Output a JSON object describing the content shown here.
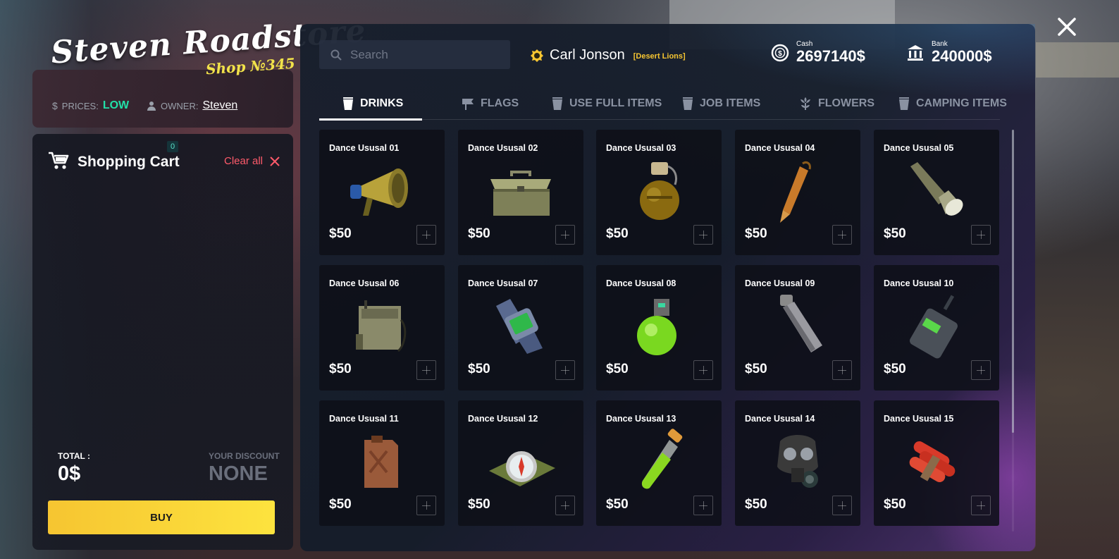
{
  "store": {
    "name": "Steven Roadstore",
    "shop_number": "Shop №345",
    "prices_label": "PRICES:",
    "prices_value": "LOW",
    "owner_label": "OWNER:",
    "owner_value": "Steven"
  },
  "cart": {
    "title": "Shopping Cart",
    "count": "0",
    "clear_label": "Clear all",
    "total_label": "TOTAL :",
    "total_value": "0$",
    "discount_label": "YOUR DISCOUNT",
    "discount_value": "NONE",
    "buy_label": "BUY"
  },
  "search": {
    "placeholder": "Search"
  },
  "user": {
    "name": "Carl Jonson",
    "gang": "[Desert Lions]"
  },
  "money": {
    "cash_label": "Cash",
    "cash_value": "2697140$",
    "bank_label": "Bank",
    "bank_value": "240000$"
  },
  "tabs": [
    {
      "label": "DRINKS",
      "icon": "cup-icon"
    },
    {
      "label": "FLAGS",
      "icon": "flag-icon"
    },
    {
      "label": "USE FULL ITEMS",
      "icon": "cup-icon"
    },
    {
      "label": "JOB ITEMS",
      "icon": "cup-icon"
    },
    {
      "label": "FLOWERS",
      "icon": "flower-icon"
    },
    {
      "label": "CAMPING ITEMS",
      "icon": "cup-icon"
    }
  ],
  "active_tab": "DRINKS",
  "items": [
    {
      "name": "Dance Ususal 01",
      "price": "$50",
      "icon": "megaphone-icon"
    },
    {
      "name": "Dance Ususal 02",
      "price": "$50",
      "icon": "toolbox-icon"
    },
    {
      "name": "Dance Ususal 03",
      "price": "$50",
      "icon": "grenade-icon"
    },
    {
      "name": "Dance Ususal 04",
      "price": "$50",
      "icon": "bullet-icon"
    },
    {
      "name": "Dance Ususal 05",
      "price": "$50",
      "icon": "flashlight-icon"
    },
    {
      "name": "Dance Ususal 06",
      "price": "$50",
      "icon": "radio-pack-icon"
    },
    {
      "name": "Dance Ususal 07",
      "price": "$50",
      "icon": "watch-icon"
    },
    {
      "name": "Dance Ususal 08",
      "price": "$50",
      "icon": "green-flask-icon"
    },
    {
      "name": "Dance Ususal 09",
      "price": "$50",
      "icon": "smoke-grenade-icon"
    },
    {
      "name": "Dance Ususal 10",
      "price": "$50",
      "icon": "walkie-talkie-icon"
    },
    {
      "name": "Dance Ususal 11",
      "price": "$50",
      "icon": "jerrycan-icon"
    },
    {
      "name": "Dance Ususal 12",
      "price": "$50",
      "icon": "compass-icon"
    },
    {
      "name": "Dance Ususal 13",
      "price": "$50",
      "icon": "test-tube-icon"
    },
    {
      "name": "Dance Ususal 14",
      "price": "$50",
      "icon": "gas-mask-icon"
    },
    {
      "name": "Dance Ususal 15",
      "price": "$50",
      "icon": "dynamite-icon"
    }
  ],
  "colors": {
    "accent_yellow": "#f6c531",
    "accent_green": "#22e0a8",
    "clear_red": "#ff5a6a"
  }
}
